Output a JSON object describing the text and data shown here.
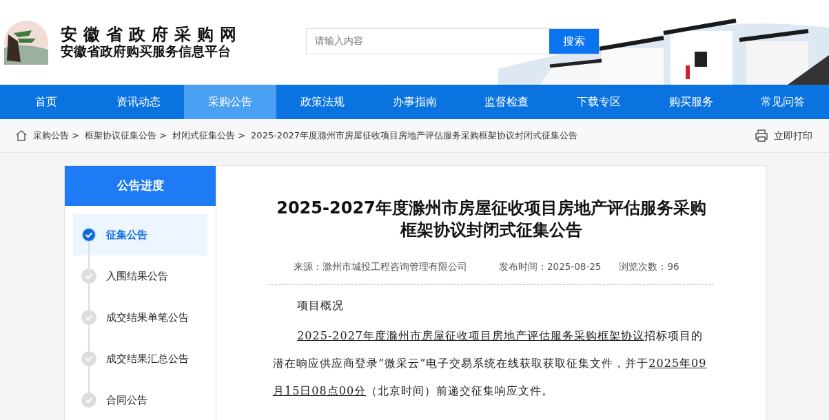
{
  "site": {
    "title": "安徽省政府采购网",
    "subtitle": "安徽省政府购买服务信息平台"
  },
  "search": {
    "placeholder": "请输入内容",
    "button": "搜索"
  },
  "nav": [
    {
      "label": "首页",
      "selected": false
    },
    {
      "label": "资讯动态",
      "selected": false
    },
    {
      "label": "采购公告",
      "selected": true
    },
    {
      "label": "政策法规",
      "selected": false
    },
    {
      "label": "办事指南",
      "selected": false
    },
    {
      "label": "监督检查",
      "selected": false
    },
    {
      "label": "下载专区",
      "selected": false
    },
    {
      "label": "购买服务",
      "selected": false
    },
    {
      "label": "常见问答",
      "selected": false
    }
  ],
  "breadcrumb": [
    "采购公告 >",
    "框架协议征集公告 >",
    "封闭式征集公告 >",
    "2025-2027年度滁州市房屋征收项目房地产评估服务采购框架协议封闭式征集公告"
  ],
  "print": "立即打印",
  "sidebar": {
    "title": "公告进度",
    "steps": [
      {
        "label": "征集公告",
        "selected": true
      },
      {
        "label": "入围结果公告",
        "selected": false
      },
      {
        "label": "成交结果单笔公告",
        "selected": false
      },
      {
        "label": "成交结果汇总公告",
        "selected": false
      },
      {
        "label": "合同公告",
        "selected": false
      }
    ]
  },
  "article": {
    "title": "2025-2027年度滁州市房屋征收项目房地产评估服务采购框架协议封闭式征集公告",
    "source": "来源：滁州市城投工程咨询管理有限公司",
    "date": "发布时间：2025-08-25",
    "views": "浏览次数：96",
    "heading": "项目概况",
    "paragraph": [
      {
        "text": "2025-2027年度滁州市房屋征收项目房地产评估服务采购框架协议",
        "underline": true
      },
      {
        "text": "招标项目的潜在响应供应商登录“微采云”电子交易系统在线获取获取征集文件，并于",
        "underline": false
      },
      {
        "text": "2025年09月15日08点00分",
        "underline": true
      },
      {
        "text": "（北京时间）前递交征集响应文件。",
        "underline": false
      }
    ]
  }
}
